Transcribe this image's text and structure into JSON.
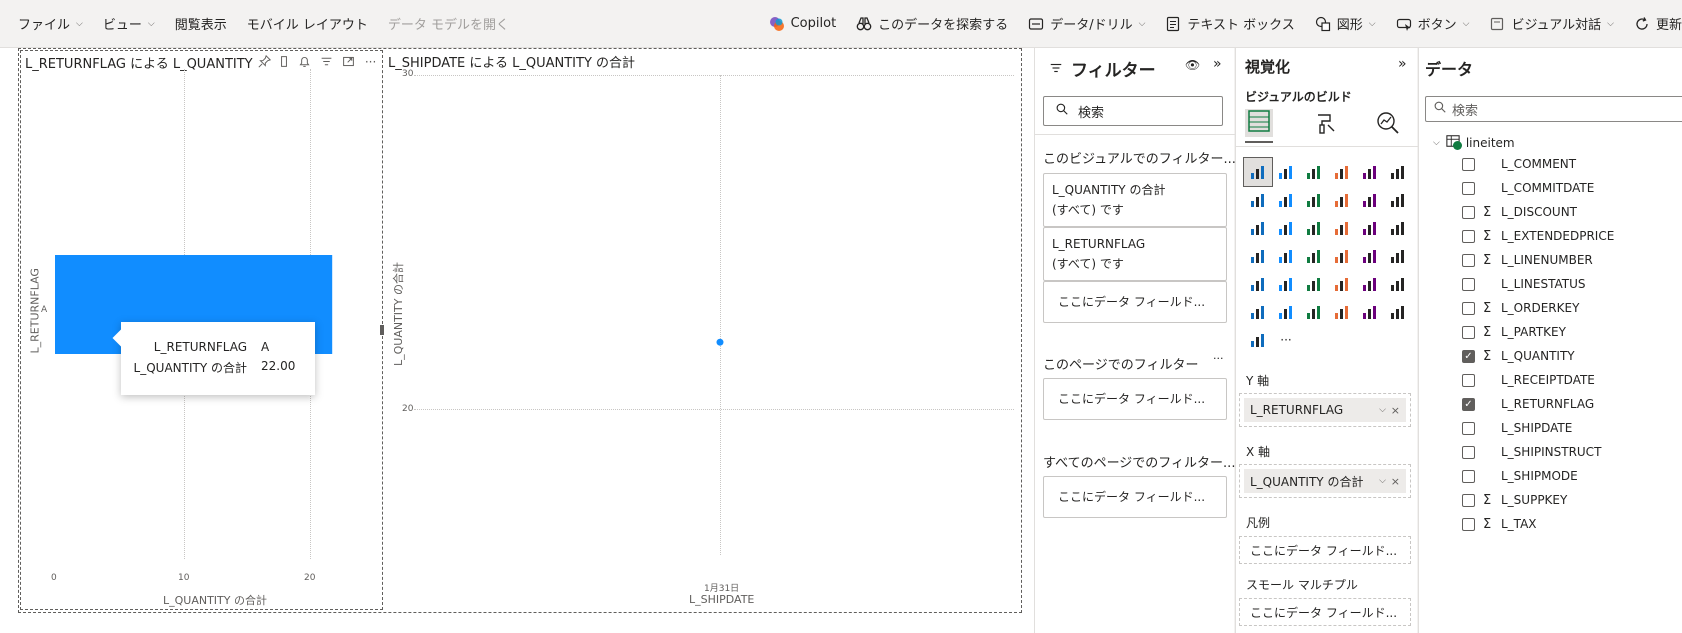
{
  "toolbar": {
    "file": "ファイル",
    "view": "ビュー",
    "reading_view": "閲覧表示",
    "mobile_layout": "モバイル レイアウト",
    "open_data_model": "データ モデルを開く",
    "copilot": "Copilot",
    "explore_data": "このデータを探索する",
    "data_drill": "データ/ドリル",
    "text_box": "テキスト ボックス",
    "shapes": "図形",
    "buttons": "ボタン",
    "visual_dialog": "ビジュアル対話",
    "refresh": "更新"
  },
  "visual1": {
    "title": "L_RETURNFLAG による L_QUANTITY",
    "y_axis_label": "L_RETURNFLAG",
    "x_axis_label": "L_QUANTITY の合計",
    "tooltip": {
      "label1": "L_RETURNFLAG",
      "value1": "A",
      "label2": "L_QUANTITY の合計",
      "value2": "22.00"
    }
  },
  "visual2": {
    "title": "L_SHIPDATE による L_QUANTITY の合計",
    "y_axis_label": "L_QUANTITY の合計",
    "x_axis_label": "L_SHIPDATE"
  },
  "chart_data": [
    {
      "type": "bar",
      "orientation": "horizontal",
      "title": "L_RETURNFLAG による L_QUANTITY",
      "xlabel": "L_QUANTITY の合計",
      "ylabel": "L_RETURNFLAG",
      "categories": [
        "A"
      ],
      "values": [
        22
      ],
      "xlim": [
        0,
        23
      ],
      "x_ticks": [
        "0",
        "10",
        "20"
      ],
      "grid": true,
      "color": "#118dff"
    },
    {
      "type": "scatter",
      "title": "L_SHIPDATE による L_QUANTITY の合計",
      "xlabel": "L_SHIPDATE",
      "ylabel": "L_QUANTITY の合計",
      "x": [
        "1月31日"
      ],
      "y": [
        22
      ],
      "ylim": [
        16,
        30
      ],
      "y_ticks": [
        "30",
        "20"
      ],
      "grid": true,
      "color": "#118dff"
    }
  ],
  "filters": {
    "title": "フィルター",
    "search_placeholder": "検索",
    "visual_section": "このビジュアルでのフィルター...",
    "cards": [
      {
        "field": "L_QUANTITY の合計",
        "state": "(すべて) です"
      },
      {
        "field": "L_RETURNFLAG",
        "state": "(すべて) です"
      }
    ],
    "drop_here": "ここにデータ フィールド...",
    "page_section": "このページでのフィルター",
    "all_pages_section": "すべてのページでのフィルター..."
  },
  "viz": {
    "title": "視覚化",
    "build": "ビジュアルのビルド",
    "y_axis": "Y 軸",
    "y_field": "L_RETURNFLAG",
    "x_axis": "X 軸",
    "x_field": "L_QUANTITY の合計",
    "legend": "凡例",
    "small_multiples": "スモール マルチプル",
    "drop_here": "ここにデータ フィールド...",
    "more": "···"
  },
  "data_pane": {
    "title": "データ",
    "search_placeholder": "検索",
    "table": "lineitem",
    "fields": [
      {
        "name": "L_COMMENT",
        "sigma": false,
        "checked": false
      },
      {
        "name": "L_COMMITDATE",
        "sigma": false,
        "checked": false
      },
      {
        "name": "L_DISCOUNT",
        "sigma": true,
        "checked": false
      },
      {
        "name": "L_EXTENDEDPRICE",
        "sigma": true,
        "checked": false
      },
      {
        "name": "L_LINENUMBER",
        "sigma": true,
        "checked": false
      },
      {
        "name": "L_LINESTATUS",
        "sigma": false,
        "checked": false
      },
      {
        "name": "L_ORDERKEY",
        "sigma": true,
        "checked": false
      },
      {
        "name": "L_PARTKEY",
        "sigma": true,
        "checked": false
      },
      {
        "name": "L_QUANTITY",
        "sigma": true,
        "checked": true
      },
      {
        "name": "L_RECEIPTDATE",
        "sigma": false,
        "checked": false
      },
      {
        "name": "L_RETURNFLAG",
        "sigma": false,
        "checked": true
      },
      {
        "name": "L_SHIPDATE",
        "sigma": false,
        "checked": false
      },
      {
        "name": "L_SHIPINSTRUCT",
        "sigma": false,
        "checked": false
      },
      {
        "name": "L_SHIPMODE",
        "sigma": false,
        "checked": false
      },
      {
        "name": "L_SUPPKEY",
        "sigma": true,
        "checked": false
      },
      {
        "name": "L_TAX",
        "sigma": true,
        "checked": false
      }
    ]
  }
}
